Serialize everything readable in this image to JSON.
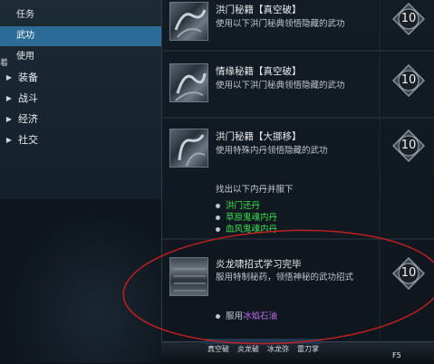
{
  "sidebar": {
    "tabs": [
      {
        "label": "任务"
      },
      {
        "label": "武功",
        "selected": true
      },
      {
        "label": "使用"
      }
    ],
    "stub_label": "着",
    "categories": [
      {
        "label": "装备"
      },
      {
        "label": "战斗"
      },
      {
        "label": "经济"
      },
      {
        "label": "社交"
      }
    ]
  },
  "entries": [
    {
      "title": "洪门秘籍【真空破】",
      "description": "使用以下洪门秘典领悟隐藏的武功",
      "level": "10"
    },
    {
      "title": "情缘秘籍【真空破】",
      "description": "使用以下洪门秘典领悟隐藏的武功",
      "level": "10"
    },
    {
      "title": "洪门秘籍【大挪移】",
      "description": "使用特殊内丹领悟隐藏的武功",
      "level": "10",
      "requirement_title": "找出以下内丹并服下",
      "requirements": [
        "洪门还丹",
        "草原鬼魂内丹",
        "血风鬼魂内丹"
      ]
    },
    {
      "title": "炎龙啸招式学习完毕",
      "description": "服用特制秘药，领悟神秘的武功招式",
      "level": "10",
      "use_prefix": "服用",
      "use_item": "冰焰石油"
    }
  ],
  "bottom_bar": {
    "skills": [
      "真空破",
      "炎龙破",
      "冰龙弥",
      "雷刀掌"
    ],
    "key_hint": "F5"
  },
  "colors": {
    "selected_tab": "#2c6a97",
    "requirement_green": "#36e14e",
    "item_purple": "#c06cf0",
    "annotation_red": "#c02020"
  }
}
